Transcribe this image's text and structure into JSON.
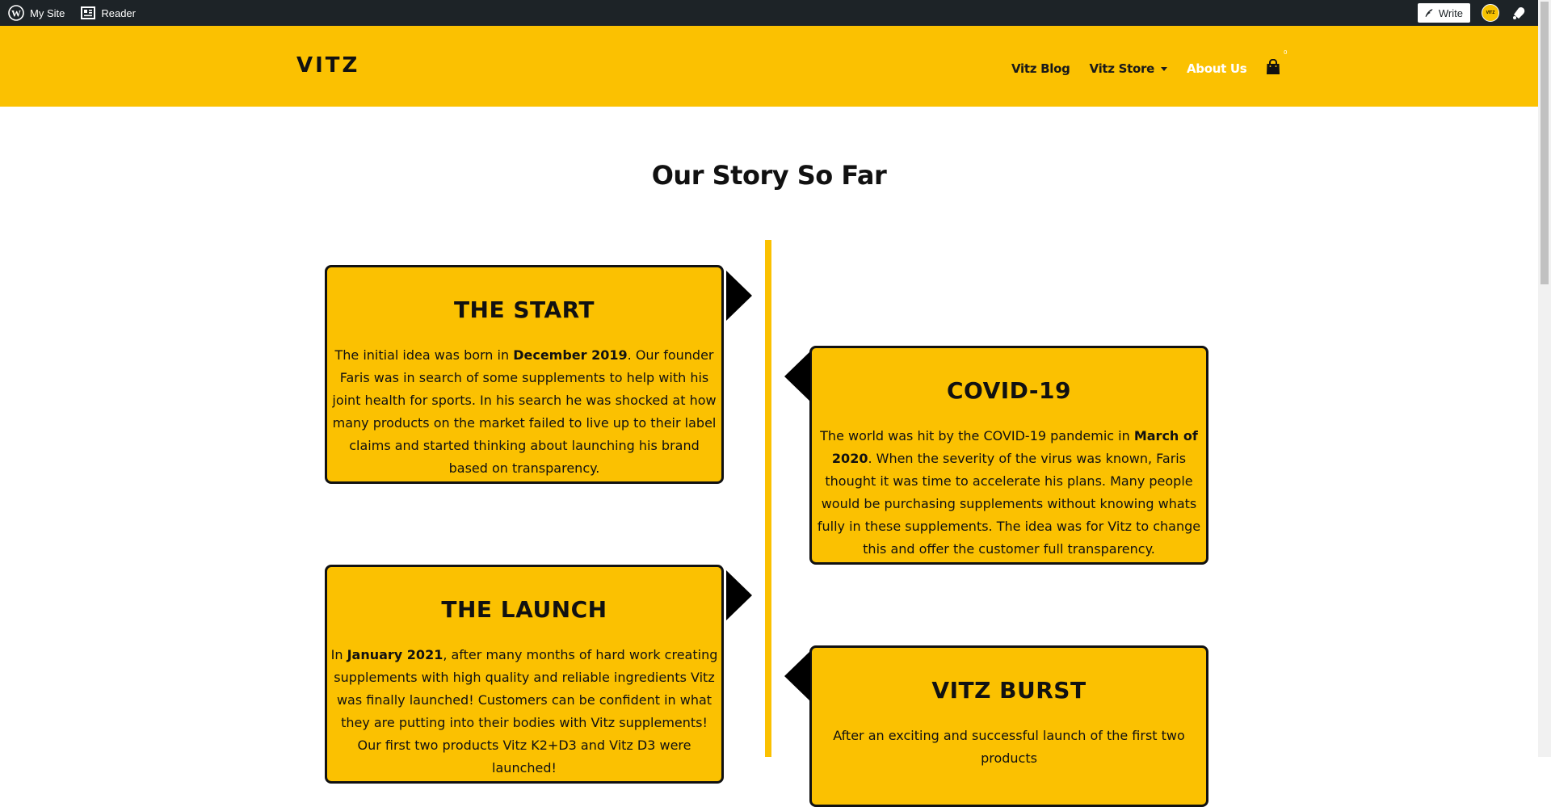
{
  "admin_bar": {
    "my_site": "My Site",
    "reader": "Reader",
    "write": "Write",
    "avatar_text": "VITZ"
  },
  "header": {
    "logo": "VITZ",
    "nav": {
      "blog": "Vitz Blog",
      "store": "Vitz Store",
      "about": "About Us"
    },
    "cart_count": "0",
    "colors": {
      "brand": "#fbc101",
      "active_nav": "#ffffff",
      "admin_bar": "#1d2327"
    }
  },
  "page": {
    "title": "Our Story So Far"
  },
  "timeline": [
    {
      "title": "THE START",
      "before": "The initial idea was born in ",
      "bold": "December 2019",
      "after": ". Our founder Faris was in search of some supplements to help with his joint health for sports. In his search he was shocked at how many products on the market failed to live up to their label claims and started thinking about launching his brand based on transparency."
    },
    {
      "title": "COVID-19",
      "before": "The world was hit by the COVID-19 pandemic in ",
      "bold": "March of 2020",
      "after": ". When the severity of the virus was known, Faris thought it was time to accelerate his plans. Many people would be purchasing supplements without knowing whats fully in these supplements. The idea was for Vitz to change this and offer the customer full transparency."
    },
    {
      "title": "THE LAUNCH",
      "before": "In ",
      "bold": "January 2021",
      "after": ", after many months of hard work creating supplements with high quality and reliable ingredients Vitz was finally launched! Customers can be confident in what they are putting into their bodies with Vitz supplements! Our first two products Vitz K2+D3 and Vitz D3 were launched!"
    },
    {
      "title": "VITZ BURST",
      "before": "After an exciting and successful launch of the first two products",
      "bold": "",
      "after": ""
    }
  ]
}
